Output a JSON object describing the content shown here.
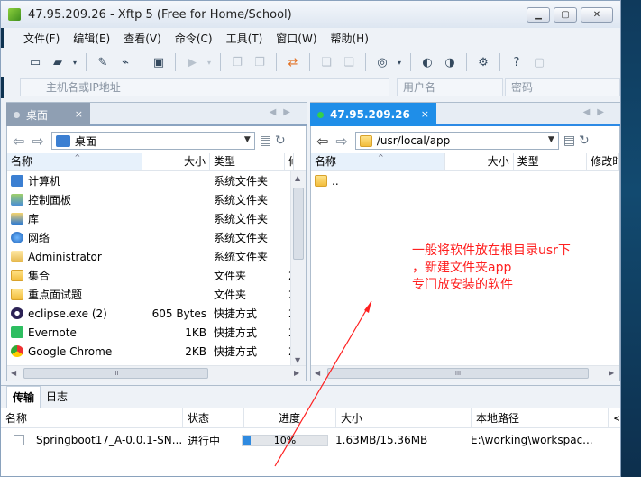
{
  "window": {
    "title": "47.95.209.26   - Xftp 5 (Free for Home/School)",
    "min": "▁",
    "max": "▢",
    "close": "✕"
  },
  "menu": [
    "文件(F)",
    "编辑(E)",
    "查看(V)",
    "命令(C)",
    "工具(T)",
    "窗口(W)",
    "帮助(H)"
  ],
  "toolbar": {
    "icons": [
      "new-session-icon",
      "open-folder-icon",
      "dropdown-icon",
      "properties-icon",
      "edit-icon",
      "reconnect-icon",
      "disconnect-icon",
      "transfer-icon",
      "copy-icon",
      "paste-icon",
      "sync-icon",
      "globe-icon",
      "dropdown-icon",
      "ftp-icon",
      "fxp-icon",
      "settings-icon",
      "help-icon",
      "chat-icon"
    ]
  },
  "address": {
    "host_placeholder": "主机名或IP地址",
    "user_placeholder": "用户名",
    "password_placeholder": "密码"
  },
  "left": {
    "tab": "桌面",
    "tab_close": "×",
    "path": "桌面",
    "columns": [
      "名称",
      "大小",
      "类型",
      "修"
    ],
    "rows": [
      {
        "icon": "i-pc",
        "name": "计算机",
        "size": "",
        "type": "系统文件夹",
        "mod": ""
      },
      {
        "icon": "i-panel",
        "name": "控制面板",
        "size": "",
        "type": "系统文件夹",
        "mod": ""
      },
      {
        "icon": "i-lib",
        "name": "库",
        "size": "",
        "type": "系统文件夹",
        "mod": ""
      },
      {
        "icon": "i-net",
        "name": "网络",
        "size": "",
        "type": "系统文件夹",
        "mod": ""
      },
      {
        "icon": "i-user",
        "name": "Administrator",
        "size": "",
        "type": "系统文件夹",
        "mod": ""
      },
      {
        "icon": "i-folder",
        "name": "集合",
        "size": "",
        "type": "文件夹",
        "mod": "2"
      },
      {
        "icon": "i-folder",
        "name": "重点面试题",
        "size": "",
        "type": "文件夹",
        "mod": "2"
      },
      {
        "icon": "i-eclipse",
        "name": "eclipse.exe (2)",
        "size": "605 Bytes",
        "type": "快捷方式",
        "mod": "2"
      },
      {
        "icon": "i-evernote",
        "name": "Evernote",
        "size": "1KB",
        "type": "快捷方式",
        "mod": "2"
      },
      {
        "icon": "i-chrome",
        "name": "Google Chrome",
        "size": "2KB",
        "type": "快捷方式",
        "mod": "2"
      }
    ],
    "hscroll_label": "III"
  },
  "right": {
    "tab": "47.95.209.26",
    "tab_close": "×",
    "path": "/usr/local/app",
    "columns": [
      "名称",
      "大小",
      "类型",
      "修改时"
    ],
    "rows": [
      {
        "icon": "i-folder",
        "name": "..",
        "size": "",
        "type": "",
        "mod": ""
      }
    ],
    "hscroll_label": "III"
  },
  "annotation": {
    "line1": "一般将软件放在根目录usr下",
    "line2": "，新建文件夹app",
    "line3": "专门放安装的软件",
    "color": "#ff2020"
  },
  "bottom": {
    "tabs": [
      "传输",
      "日志"
    ],
    "columns": [
      "名称",
      "状态",
      "进度",
      "大小",
      "本地路径",
      "<"
    ],
    "transfers": [
      {
        "name": "Springboot17_A-0.0.1-SN...",
        "status": "进行中",
        "progress": 10,
        "progress_text": "10%",
        "size": "1.63MB/15.36MB",
        "local_path": "E:\\working\\workspac..."
      }
    ]
  }
}
